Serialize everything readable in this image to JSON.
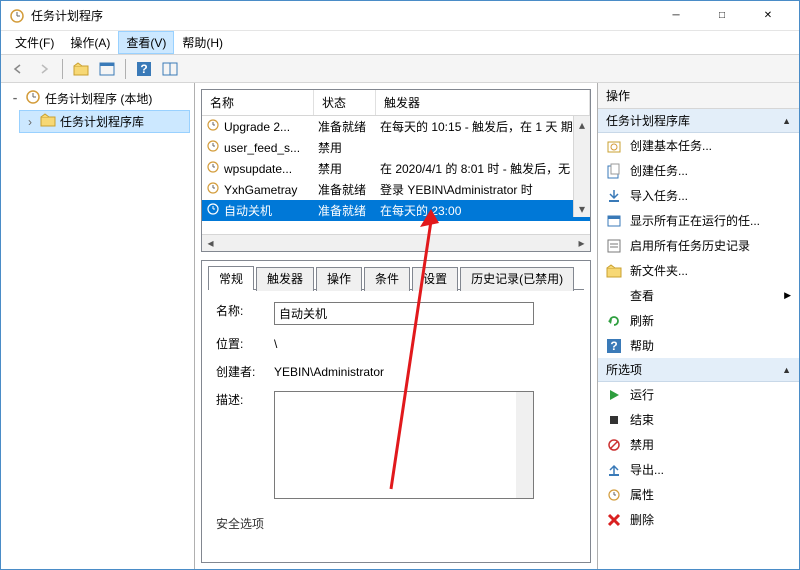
{
  "window": {
    "title": "任务计划程序"
  },
  "menu": {
    "file": "文件(F)",
    "action": "操作(A)",
    "view": "查看(V)",
    "help": "帮助(H)"
  },
  "tree": {
    "root": "任务计划程序 (本地)",
    "child": "任务计划程序库"
  },
  "tasklist": {
    "headers": {
      "name": "名称",
      "status": "状态",
      "trigger": "触发器"
    },
    "rows": [
      {
        "name": "Upgrade 2...",
        "status": "准备就绪",
        "trigger": "在每天的 10:15 - 触发后，在 1 天 期"
      },
      {
        "name": "user_feed_s...",
        "status": "禁用",
        "trigger": ""
      },
      {
        "name": "wpsupdate...",
        "status": "禁用",
        "trigger": "在 2020/4/1 的 8:01 时 - 触发后，无"
      },
      {
        "name": "YxhGametray",
        "status": "准备就绪",
        "trigger": "登录 YEBIN\\Administrator 时"
      },
      {
        "name": "自动关机",
        "status": "准备就绪",
        "trigger": "在每天的 23:00"
      }
    ]
  },
  "tabs": {
    "general": "常规",
    "triggers": "触发器",
    "actions": "操作",
    "conditions": "条件",
    "settings": "设置",
    "history": "历史记录(已禁用)"
  },
  "form": {
    "name_label": "名称:",
    "name_value": "自动关机",
    "location_label": "位置:",
    "location_value": "\\",
    "creator_label": "创建者:",
    "creator_value": "YEBIN\\Administrator",
    "desc_label": "描述:"
  },
  "security_header": "安全选项",
  "actions_pane": {
    "header": "操作",
    "group1": "任务计划程序库",
    "items1": [
      {
        "icon": "new-basic",
        "label": "创建基本任务..."
      },
      {
        "icon": "new-task",
        "label": "创建任务..."
      },
      {
        "icon": "import",
        "label": "导入任务..."
      },
      {
        "icon": "running",
        "label": "显示所有正在运行的任..."
      },
      {
        "icon": "enable-history",
        "label": "启用所有任务历史记录"
      },
      {
        "icon": "new-folder",
        "label": "新文件夹..."
      },
      {
        "icon": "view",
        "label": "查看",
        "chev": true
      },
      {
        "icon": "refresh",
        "label": "刷新"
      },
      {
        "icon": "help",
        "label": "帮助"
      }
    ],
    "group2": "所选项",
    "items2": [
      {
        "icon": "run",
        "label": "运行"
      },
      {
        "icon": "end",
        "label": "结束"
      },
      {
        "icon": "disable",
        "label": "禁用"
      },
      {
        "icon": "export",
        "label": "导出..."
      },
      {
        "icon": "properties",
        "label": "属性"
      },
      {
        "icon": "delete",
        "label": "删除"
      }
    ]
  }
}
